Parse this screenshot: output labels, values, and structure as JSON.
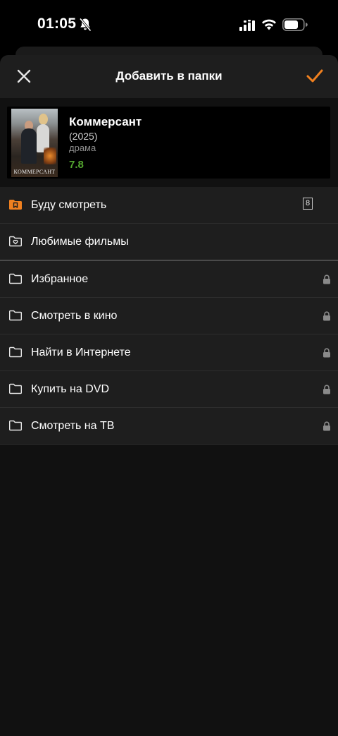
{
  "status_bar": {
    "time": "01:05",
    "icons": [
      "bell-slash-icon",
      "signal-icon",
      "wifi-icon",
      "battery-icon"
    ]
  },
  "header": {
    "title": "Добавить в папки",
    "close_icon": "close-icon",
    "done_icon": "checkmark-icon",
    "accent_color": "#f0801f"
  },
  "movie": {
    "title": "Коммерсант",
    "year": "(2025)",
    "genre": "драма",
    "rating": "7.8",
    "rating_color": "#54a62f",
    "poster_caption": "КОММЕРСАНТ"
  },
  "folders": [
    {
      "label": "Буду смотреть",
      "icon": "bookmark-folder-icon",
      "count": "8",
      "locked": false
    },
    {
      "label": "Любимые фильмы",
      "icon": "heart-folder-icon",
      "locked": false
    },
    {
      "label": "Избранное",
      "icon": "folder-icon",
      "locked": true
    },
    {
      "label": "Смотреть в кино",
      "icon": "folder-icon",
      "locked": true
    },
    {
      "label": "Найти в Интернете",
      "icon": "folder-icon",
      "locked": true
    },
    {
      "label": "Купить на DVD",
      "icon": "folder-icon",
      "locked": true
    },
    {
      "label": "Смотреть на ТВ",
      "icon": "folder-icon",
      "locked": true
    }
  ]
}
